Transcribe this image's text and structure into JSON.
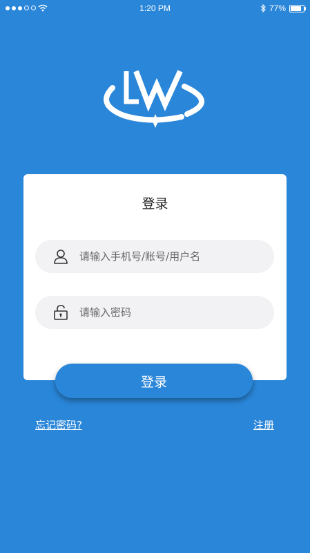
{
  "status_bar": {
    "time": "1:20 PM",
    "battery": "77%"
  },
  "card": {
    "title": "登录",
    "username_placeholder": "请输入手机号/账号/用户名",
    "password_placeholder": "请输入密码"
  },
  "login_button": "登录",
  "links": {
    "forgot": "忘记密码?",
    "register": "注册"
  },
  "colors": {
    "background": "#2a86d9",
    "card": "#ffffff",
    "field": "#f2f2f4"
  },
  "icons": [
    "signal-icon",
    "wifi-icon",
    "bluetooth-icon",
    "battery-icon",
    "user-icon",
    "lock-icon",
    "logo-icon"
  ]
}
